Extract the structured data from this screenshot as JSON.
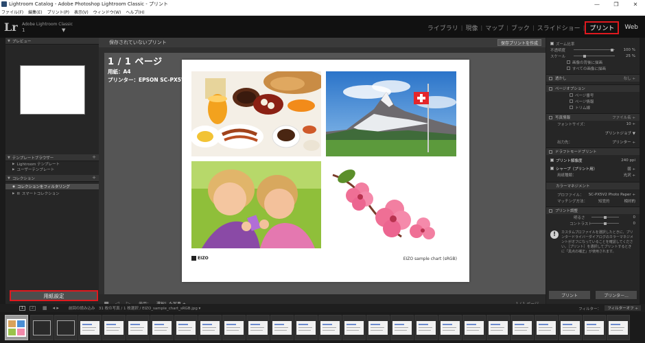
{
  "window": {
    "title": "Lightroom Catalog - Adobe Photoshop Lightroom Classic - プリント",
    "minimize": "—",
    "restore": "❐",
    "close": "✕"
  },
  "menu": [
    "ファイル(F)",
    "編集(E)",
    "プリント(P)",
    "表示(V)",
    "ウィンドウ(W)",
    "ヘルプ(H)"
  ],
  "identity": {
    "logo": "Lr",
    "app_name": "Adobe Lightroom Classic",
    "catalog": "1",
    "caret": "▼"
  },
  "modules": {
    "library": "ライブラリ",
    "develop": "現像",
    "map": "マップ",
    "book": "ブック",
    "slideshow": "スライドショー",
    "print": "プリント",
    "web": "Web",
    "separator": "|"
  },
  "left_panel": {
    "preview_header": "プレビュー",
    "template_browser_header": "テンプレートブラウザー",
    "templates": [
      "Lightroom テンプレート",
      "ユーザーテンプレート"
    ],
    "collections_header": "コレクション",
    "collections": [
      "コレクションをフィルタリング",
      "スマートコレクション"
    ],
    "plus": "+",
    "page_setup_button": "用紙設定"
  },
  "center": {
    "unsaved_print": "保存されていないプリント",
    "save_print_button": "保存プリントを作成",
    "page_label": "1 / 1 ページ",
    "paper": "用紙：A4",
    "printer": "プリンター：EPSON SC-PX5V2",
    "eizo_logo": "EIZO",
    "sample_caption": "EIZO sample chart (sRGB)",
    "toolbar": {
      "use_label": "使用：",
      "use_value": "選択した写真 ÷",
      "page_count": "1 / 1 ページ"
    }
  },
  "right_panel": {
    "top_rows": [
      {
        "label": "ズーム比率",
        "value": ""
      },
      {
        "label": "不透明度",
        "value": "100 %"
      },
      {
        "label": "スケール",
        "value": "25 %"
      },
      {
        "label": "画像の背後に描画",
        "value": ""
      },
      {
        "label": "すべての画像に描画",
        "value": ""
      }
    ],
    "sections": {
      "watermark": "透かし",
      "watermark_val": "なし ÷",
      "page_options": "ページオプション",
      "page_options_items": [
        "ページ番号",
        "ページ情報",
        "トリム線"
      ],
      "photo_info": "写真情報",
      "photo_info_val": "ファイル名 ÷",
      "font_size_label": "フォントサイズ：",
      "font_size_value": "10 ÷",
      "print_job": "プリントジョブ ▼",
      "output_label": "出力先：",
      "output_value": "プリンター ÷",
      "draft_mode": "ドラフトモードプリント",
      "resolution_label": "プリント解像度",
      "resolution_value": "240 ppi",
      "sharpen_label": "シャープ（プリント用）",
      "sharpen_value": "弱 ÷",
      "media_label": "用紙種類：",
      "media_value": "光沢 ÷",
      "color_management": "カラーマネジメント",
      "profile_label": "プロファイル：",
      "profile_value": "SC-PX5V2 Photo Paper ÷",
      "intent_label": "マッチング方法：",
      "intent_perceptual": "知覚的",
      "intent_relative": "相対的",
      "print_adjust": "プリント調整",
      "brightness": "明るさ",
      "contrast": "コントラスト",
      "zero": "0",
      "warning_icon": "!",
      "warning_text": "カスタムプロファイルを選択したときに、プリンタードライバーダイアログのカラーマネジメントがオフになっていることを確認してください。［プリント］を選択してプリントするときに「黒点の補正」が使用されます。"
    },
    "print_button": "プリント",
    "printer_button": "プリンター..."
  },
  "filmstrip": {
    "monitor1": "1",
    "monitor2": "2",
    "grid_icon": "▦",
    "nav_arrows": "◂ ▸",
    "source": "前回の読み込み　31 枚の写真 / 1 枚選択 / EIZO_sample_chart_sRGB.jpg ▾",
    "filter_label": "フィルター：",
    "filter_value": "フィルターオフ ÷"
  },
  "colors": {
    "highlight_red": "#e0191e",
    "panel": "#262626",
    "workspace": "#555555"
  }
}
